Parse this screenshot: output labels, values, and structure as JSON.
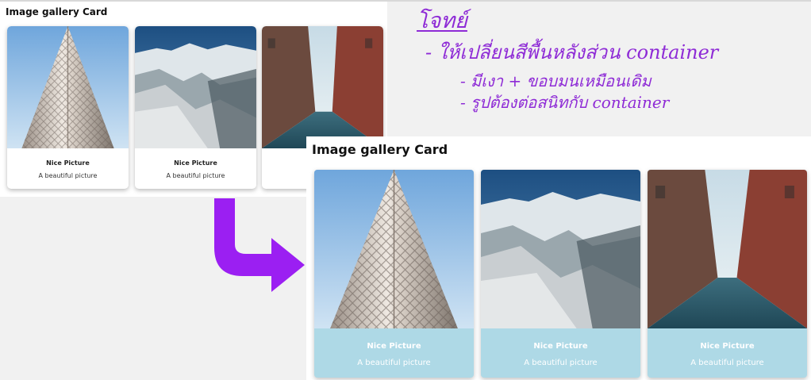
{
  "before": {
    "title": "Image gallery Card",
    "cards": [
      {
        "name": "Nice Picture",
        "description": "A beautiful picture"
      },
      {
        "name": "Nice Picture",
        "description": "A beautiful picture"
      },
      {
        "name": "Ni",
        "description": "A b"
      }
    ]
  },
  "annotation": {
    "title": "โจทย์",
    "line1": "- ให้เปลี่ยนสีพื้นหลังส่วน container",
    "line2": "- มีเงา + ขอบมนเหมือนเดิม",
    "line3": "- รูปต้องต่อสนิทกับ container",
    "color": "#8e2bd6"
  },
  "arrow": {
    "color": "#9b1ff2"
  },
  "after": {
    "title": "Image gallery Card",
    "card_background": "#aed9e6",
    "cards": [
      {
        "name": "Nice Picture",
        "description": "A beautiful picture"
      },
      {
        "name": "Nice Picture",
        "description": "A beautiful picture"
      },
      {
        "name": "Nice Picture",
        "description": "A beautiful picture"
      }
    ]
  }
}
